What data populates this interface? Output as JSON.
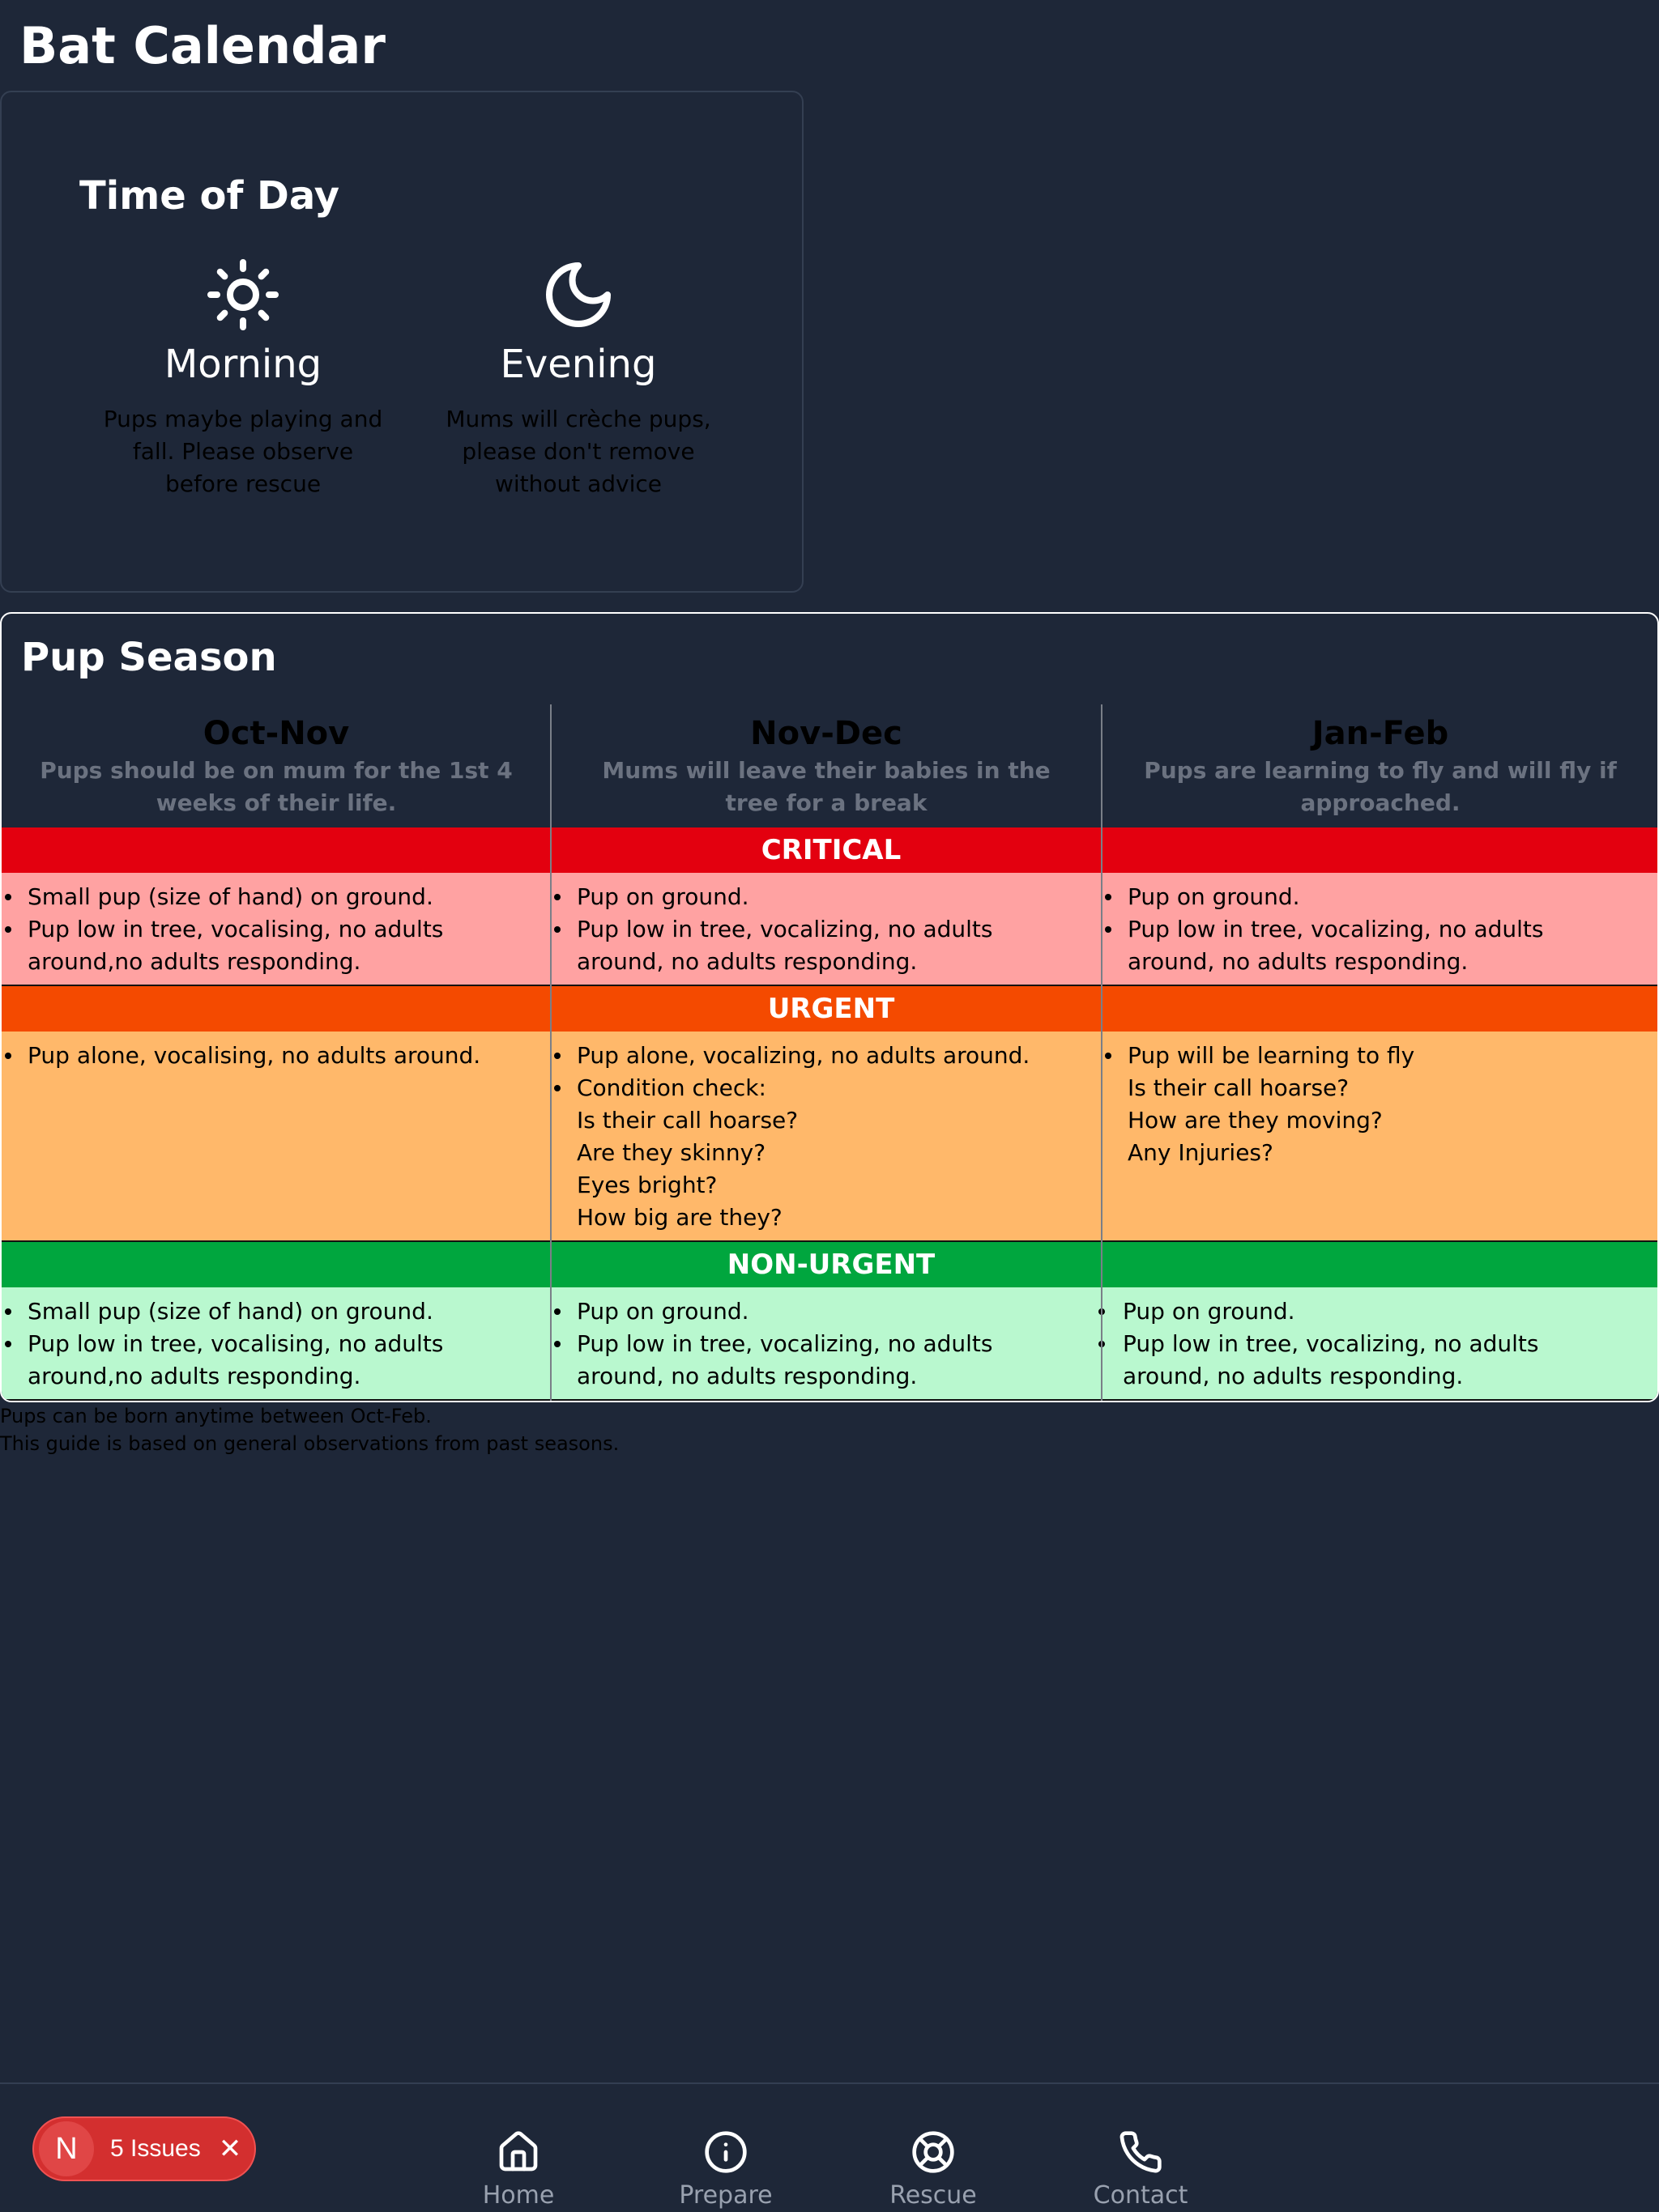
{
  "page": {
    "title": "Bat Calendar"
  },
  "time_of_day": {
    "title": "Time of Day",
    "morning": {
      "label": "Morning",
      "icon": "sun-icon",
      "desc": "Pups maybe playing and fall. Please observe before rescue"
    },
    "evening": {
      "label": "Evening",
      "icon": "moon-icon",
      "desc": "Mums will crèche pups, please don't remove without advice"
    }
  },
  "pup_season": {
    "title": "Pup Season",
    "seasons": [
      {
        "name": "Oct-Nov",
        "desc": "Pups should be on mum for the 1st 4 weeks of their life."
      },
      {
        "name": "Nov-Dec",
        "desc": "Mums will leave their babies in the tree for a break"
      },
      {
        "name": "Jan-Feb",
        "desc": "Pups are learning to fly and will fly if approached."
      }
    ],
    "levels": {
      "critical": {
        "label": "CRITICAL",
        "color": "#e3000f",
        "cells": [
          [
            "Small pup (size of hand) on ground.",
            "Pup low in tree, vocalising, no adults around,no adults responding."
          ],
          [
            "Pup on ground.",
            "Pup low in tree, vocalizing, no adults around, no adults responding."
          ],
          [
            "Pup on ground.",
            "Pup low in tree, vocalizing, no adults around, no adults responding."
          ]
        ]
      },
      "urgent": {
        "label": "URGENT",
        "color": "#f44a00",
        "cells": [
          [
            "Pup alone, vocalising, no adults around."
          ],
          [
            "Pup alone, vocalizing, no adults around.",
            "Condition check:",
            "Is their call hoarse?",
            "Are they skinny?",
            "Eyes bright?",
            "How big are they?"
          ],
          [
            "Pup will be learning to fly",
            "Is their call hoarse?",
            "How are they moving?",
            "Any Injuries?"
          ]
        ]
      },
      "nonurgent": {
        "label": "NON-URGENT",
        "color": "#00a63e",
        "cells": [
          [
            "Small pup (size of hand) on ground.",
            "Pup low in tree, vocalising, no adults around,no adults responding."
          ],
          [
            "Pup on ground.",
            "Pup low in tree, vocalizing, no adults around, no adults responding."
          ],
          [
            "Pup on ground.",
            "Pup low in tree, vocalizing, no adults around, no adults responding."
          ]
        ]
      }
    }
  },
  "footnotes": {
    "line1": "Pups can be born anytime between Oct-Feb.",
    "line2": "This guide is based on general observations from past seasons."
  },
  "nav": {
    "home": {
      "label": "Home",
      "icon": "home-icon"
    },
    "prepare": {
      "label": "Prepare",
      "icon": "info-icon"
    },
    "rescue": {
      "label": "Rescue",
      "icon": "lifebuoy-icon"
    },
    "contact": {
      "label": "Contact",
      "icon": "phone-icon"
    }
  },
  "issues": {
    "badge": "N",
    "label": "5 Issues"
  }
}
